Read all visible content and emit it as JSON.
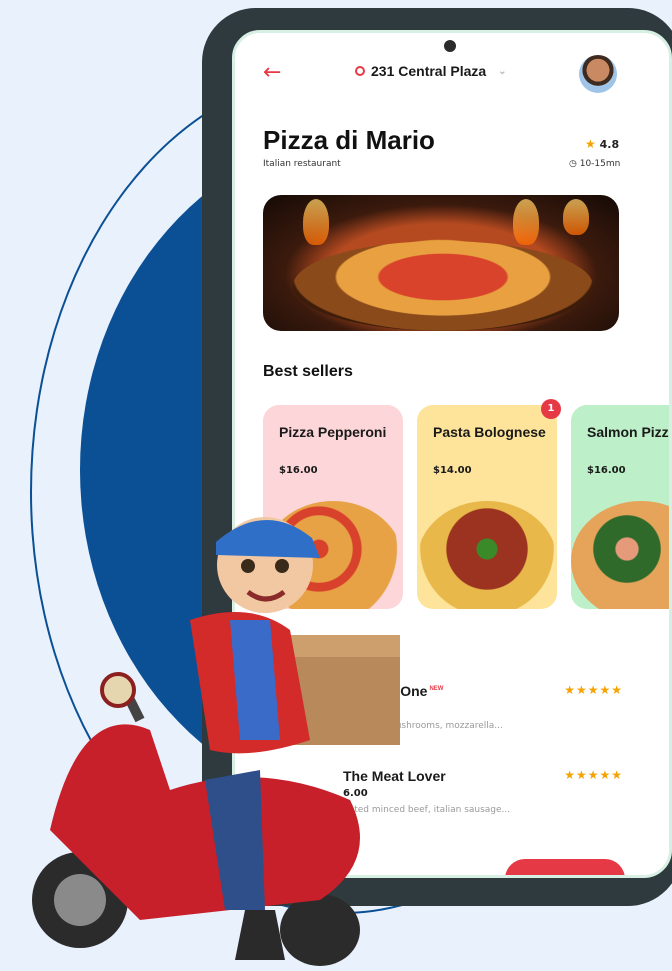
{
  "header": {
    "location": "231 Central Plaza"
  },
  "restaurant": {
    "name": "Pizza di Mario",
    "category": "Italian restaurant",
    "rating": "4.8",
    "delivery_time": "10-15mn"
  },
  "best_sellers": {
    "title": "Best sellers",
    "cart_badge": "1",
    "items": [
      {
        "name": "Pizza Pepperoni",
        "price": "$16.00",
        "color": "#fcd6d8"
      },
      {
        "name": "Pasta Bolognese",
        "price": "$14.00",
        "color": "#fde49a"
      },
      {
        "name": "Salmon Pizza",
        "price": "$16.00",
        "color": "#bdf0c8"
      }
    ]
  },
  "menu": [
    {
      "title": "cial One",
      "badge": "NEW",
      "stars": "★★★★★",
      "price": "",
      "desc": "ni, mushrooms, mozzarella..."
    },
    {
      "title": "The Meat Lover",
      "badge": "",
      "stars": "★★★★★",
      "price": "6.00",
      "desc": "nated minced beef, italian sausage..."
    }
  ],
  "colors": {
    "accent": "#e63946",
    "brand_blue": "#0b4f94",
    "star": "#f4a300"
  },
  "icons": [
    "back-arrow-icon",
    "location-pin-icon",
    "chevron-down-icon",
    "star-icon",
    "clock-icon"
  ]
}
